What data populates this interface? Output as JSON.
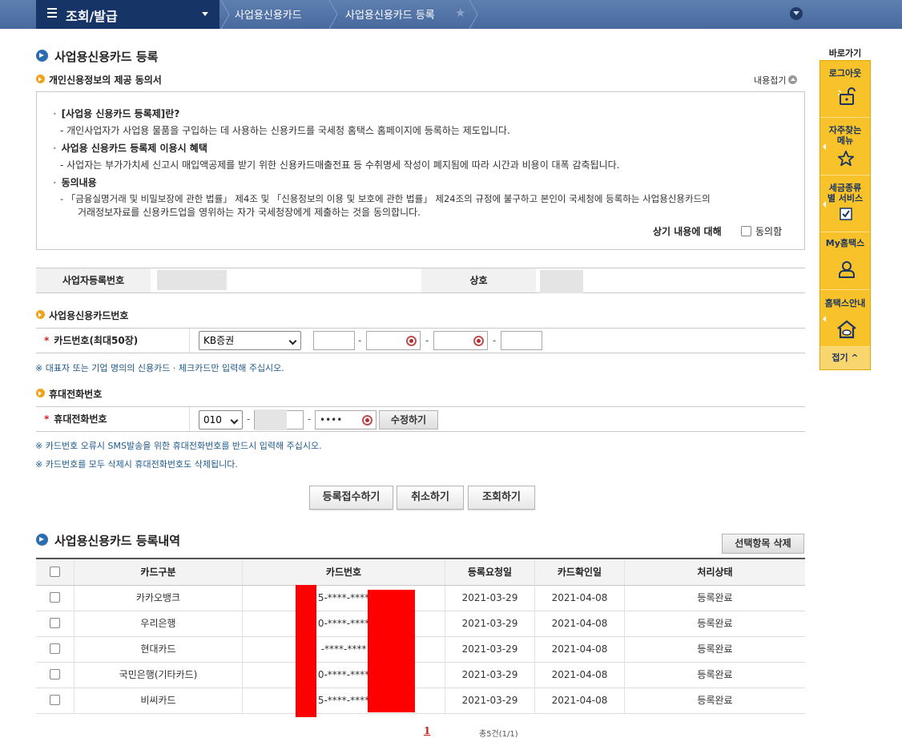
{
  "topbar": {
    "menu_title": "조회/발급",
    "breadcrumbs": [
      "사업용신용카드",
      "사업용신용카드 등록"
    ]
  },
  "page_title": "사업용신용카드 등록",
  "consent": {
    "title": "개인신용정보의 제공 동의서",
    "collapse_label": "내용접기",
    "q1": "[사업용 신용카드 등록제]란?",
    "a1": "- 개인사업자가 사업용 물품을 구입하는 데 사용하는 신용카드를 국세청 홈택스 홈페이지에 등록하는 제도입니다.",
    "q2": "사업용 신용카드 등록제 이용시 혜택",
    "a2": "- 사업자는 부가가치세 신고시 매입액공제를 받기 위한 신용카드매출전표 등 수취명세 작성이 폐지됨에 따라 시간과 비용이 대폭 감축됩니다.",
    "q3": "동의내용",
    "a3_line1": "- 「금융실명거래 및 비밀보장에 관한 법률」 제4조 및 「신용정보의 이용 및 보호에 관한 법률」 제24조의 규정에 불구하고 본인이 국세청에 등록하는 사업용신용카드의",
    "a3_line2": "거래정보자료를 신용카드업을 영위하는 자가 국세청장에게 제출하는 것을 동의합니다.",
    "agree_prefix": "상기 내용에 대해",
    "agree_label": "동의함"
  },
  "business": {
    "reg_no_label": "사업자등록번호",
    "trade_name_label": "상호"
  },
  "card_section": {
    "title": "사업용신용카드번호",
    "field_label": "카드번호(최대50장)",
    "company_selected": "KB증권",
    "note": "※ 대표자 또는 기업 명의의 신용카드 · 체크카드만 입력해 주십시오."
  },
  "phone_section": {
    "title": "휴대전화번호",
    "field_label": "휴대전화번호",
    "prefix_selected": "010",
    "last_masked": "••••",
    "edit_button": "수정하기",
    "note1": "※ 카드번호 오류시 SMS발송을 위한 휴대전화번호를 반드시 입력해 주십시오.",
    "note2": "※ 카드번호를 모두 삭제시 휴대전화번호도 삭제됩니다."
  },
  "actions": {
    "submit": "등록접수하기",
    "cancel": "취소하기",
    "search": "조회하기"
  },
  "history": {
    "title": "사업용신용카드 등록내역",
    "delete_button": "선택항목 삭제",
    "columns": [
      "카드구분",
      "카드번호",
      "등록요청일",
      "카드확인일",
      "처리상태"
    ],
    "rows": [
      {
        "company": "카카오뱅크",
        "card": "5-****-****",
        "req": "2021-03-29",
        "conf": "2021-04-08",
        "status": "등록완료"
      },
      {
        "company": "우리은행",
        "card": "0-****-****",
        "req": "2021-03-29",
        "conf": "2021-04-08",
        "status": "등록완료"
      },
      {
        "company": "현대카드",
        "card": "-****-****",
        "req": "2021-03-29",
        "conf": "2021-04-08",
        "status": "등록완료"
      },
      {
        "company": "국민은행(기타카드)",
        "card": "0-****-****",
        "req": "2021-03-29",
        "conf": "2021-04-08",
        "status": "등록완료"
      },
      {
        "company": "비씨카드",
        "card": "5-****-****",
        "req": "2021-03-29",
        "conf": "2021-04-08",
        "status": "등록완료"
      }
    ],
    "page": "1",
    "total": "총5건(1/1)"
  },
  "quick_menu": {
    "title": "바로가기",
    "items": [
      "로그아웃",
      "자주찾는 메뉴",
      "세금종류별 서비스",
      "My홈택스",
      "홈택스안내"
    ],
    "fold": "접기 ^"
  },
  "colors": {
    "topbar": "#48699d",
    "menu_box": "#163466",
    "accent_yellow": "#f7c22a",
    "redaction": "#ff0000"
  }
}
